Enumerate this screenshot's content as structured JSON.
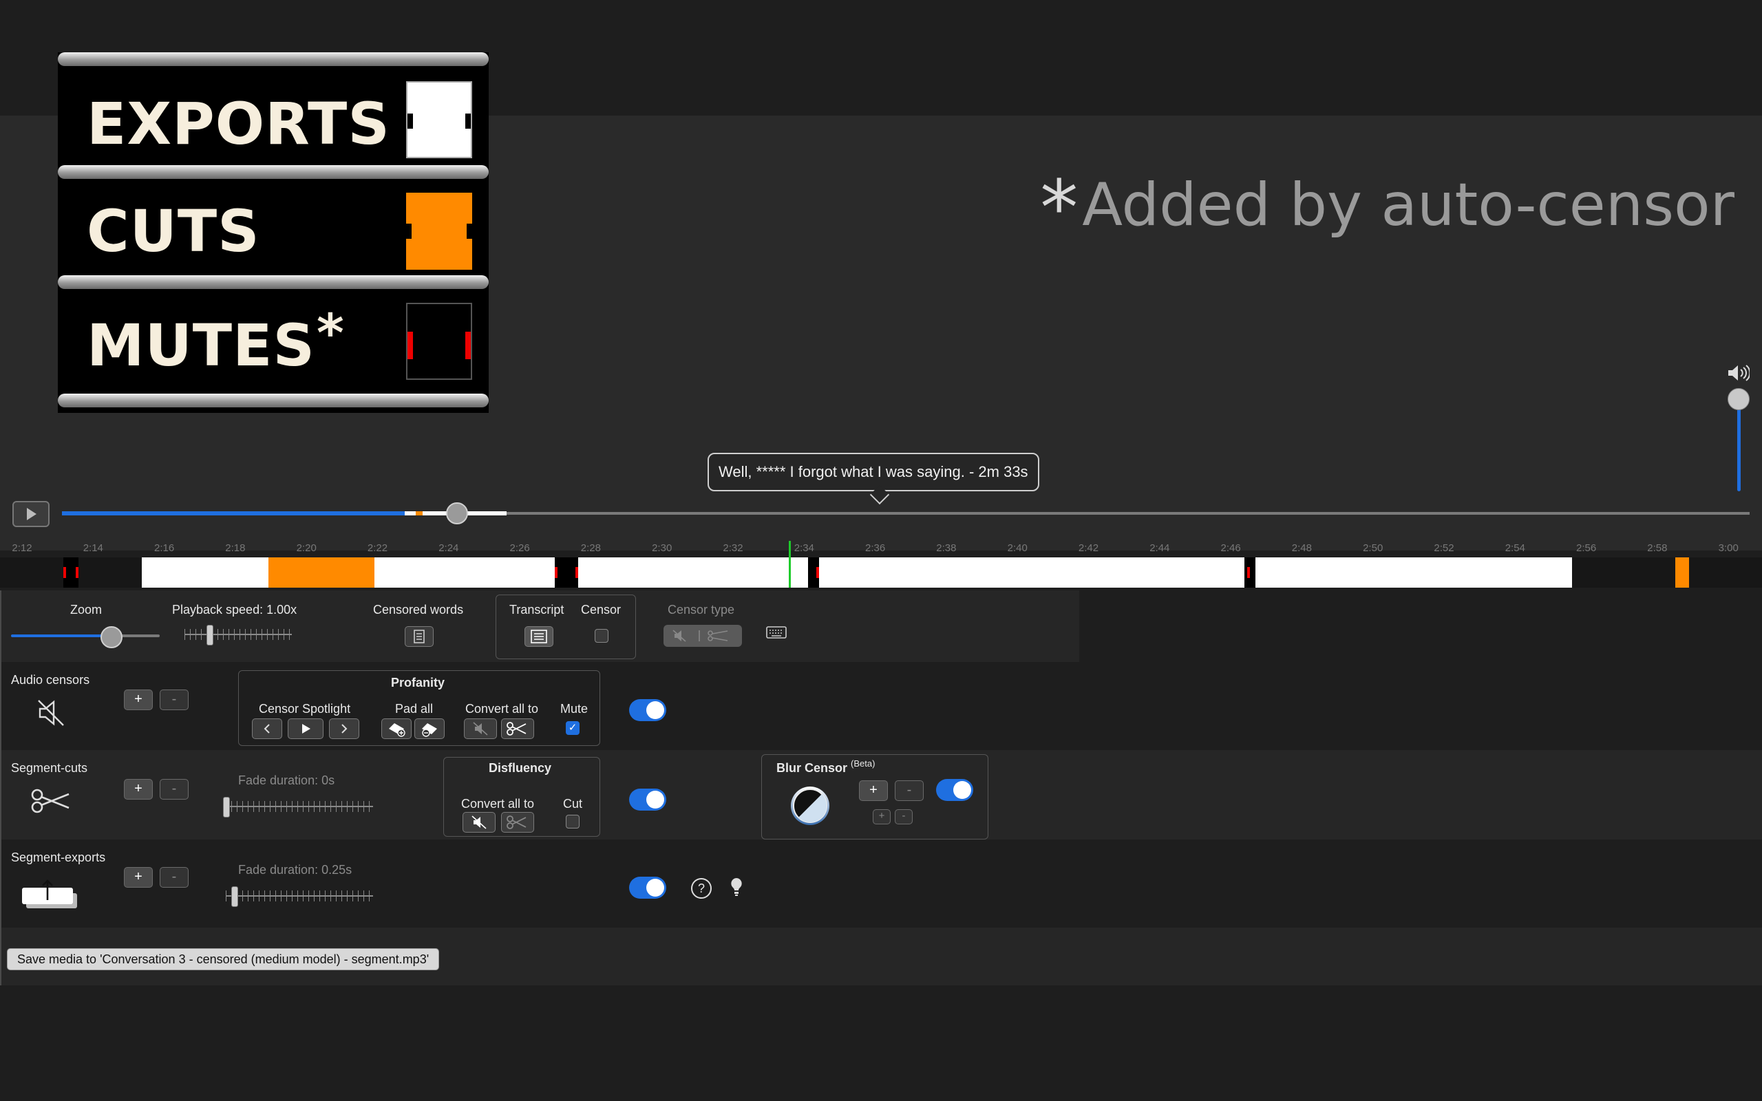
{
  "legend": {
    "items": [
      {
        "label": "EXPORTS",
        "star": ""
      },
      {
        "label": "CUTS",
        "star": ""
      },
      {
        "label": "MUTES",
        "star": "*"
      }
    ]
  },
  "note": {
    "star": "*",
    "text": "Added by auto-censor"
  },
  "player": {
    "tooltip": "Well, ***** I forgot what I was saying. - 2m 33s",
    "progress": 0.2
  },
  "timeline": {
    "ticks": [
      "2:12",
      "2:14",
      "2:16",
      "2:18",
      "2:20",
      "2:22",
      "2:24",
      "2:26",
      "2:28",
      "2:30",
      "2:32",
      "2:34",
      "2:36",
      "2:38",
      "2:40",
      "2:42",
      "2:44",
      "2:46",
      "2:48",
      "2:50",
      "2:52",
      "2:54",
      "2:56",
      "2:58",
      "3:00"
    ]
  },
  "controls": {
    "zoom_label": "Zoom",
    "speed_label": "Playback speed: 1.00x",
    "censored_words_label": "Censored words",
    "transcript_label": "Transcript",
    "censor_label": "Censor",
    "censor_type_label": "Censor type"
  },
  "rows": {
    "audio": {
      "title": "Audio censors",
      "plus": "+",
      "minus": "-",
      "profanity_title": "Profanity",
      "spotlight_label": "Censor Spotlight",
      "pad_all_label": "Pad all",
      "convert_all_label": "Convert all to",
      "mute_label": "Mute"
    },
    "cuts": {
      "title": "Segment-cuts",
      "plus": "+",
      "minus": "-",
      "fade_label": "Fade duration: 0s",
      "disfluency_title": "Disfluency",
      "convert_all_label": "Convert all to",
      "cut_label": "Cut",
      "blur_title": "Blur Censor",
      "blur_beta": "(Beta)"
    },
    "exports": {
      "title": "Segment-exports",
      "plus": "+",
      "minus": "-",
      "fade_label": "Fade duration: 0.25s",
      "help": "?"
    }
  },
  "save_button": "Save media to 'Conversation 3 - censored (medium model) - segment.mp3'",
  "colors": {
    "accent": "#1f6fe0",
    "cut": "#ff8a00",
    "mute": "#e00000",
    "playhead": "#1ecb2b"
  }
}
